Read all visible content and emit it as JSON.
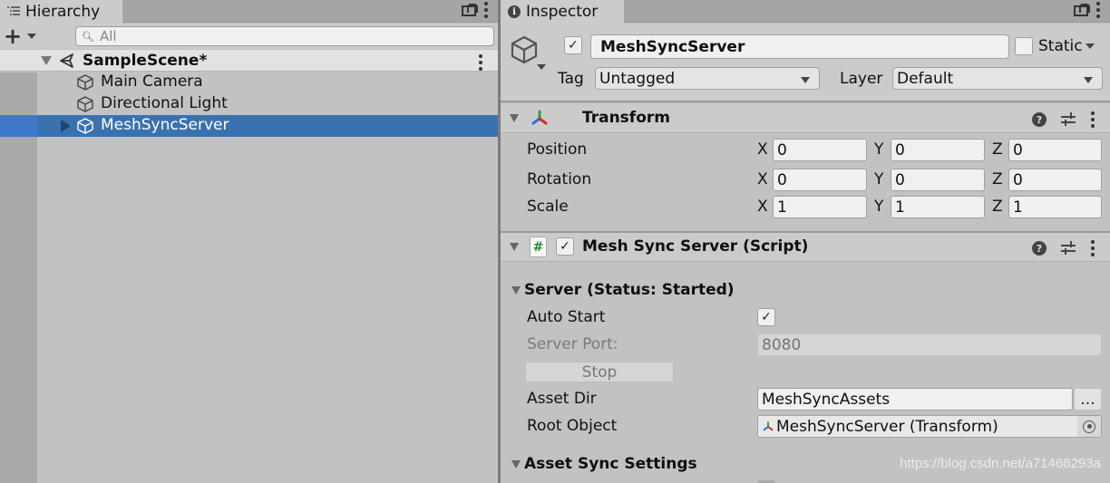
{
  "hierarchy": {
    "tab_label": "Hierarchy",
    "search_placeholder": "All",
    "scene": {
      "name": "SampleScene*"
    },
    "items": [
      {
        "label": "Main Camera",
        "selected": false
      },
      {
        "label": "Directional Light",
        "selected": false
      },
      {
        "label": "MeshSyncServer",
        "selected": true
      }
    ]
  },
  "inspector": {
    "tab_label": "Inspector",
    "gameobject": {
      "active": true,
      "name": "MeshSyncServer",
      "static_label": "Static",
      "static": false,
      "tag_label": "Tag",
      "tag_value": "Untagged",
      "layer_label": "Layer",
      "layer_value": "Default"
    },
    "transform": {
      "title": "Transform",
      "rows": [
        {
          "label": "Position",
          "x": "0",
          "y": "0",
          "z": "0"
        },
        {
          "label": "Rotation",
          "x": "0",
          "y": "0",
          "z": "0"
        },
        {
          "label": "Scale",
          "x": "1",
          "y": "1",
          "z": "1"
        }
      ],
      "axis_labels": {
        "x": "X",
        "y": "Y",
        "z": "Z"
      }
    },
    "script": {
      "title": "Mesh Sync Server (Script)",
      "enabled": true,
      "server_section": "Server (Status: Started)",
      "auto_start_label": "Auto Start",
      "auto_start": true,
      "server_port_label": "Server Port:",
      "server_port": "8080",
      "stop_label": "Stop",
      "asset_dir_label": "Asset Dir",
      "asset_dir": "MeshSyncAssets",
      "browse_label": "...",
      "root_object_label": "Root Object",
      "root_object": "MeshSyncServer (Transform)",
      "asset_sync_section": "Asset Sync Settings"
    }
  },
  "watermark": "https://blog.csdn.net/a71468293a",
  "colors": {
    "selection": "#3a72b0",
    "panel_bg": "#c2c2c2",
    "header_bg": "#cbcbcb",
    "axis_red": "#d62b2b",
    "axis_green": "#2fa03a",
    "axis_blue": "#2474d4"
  }
}
